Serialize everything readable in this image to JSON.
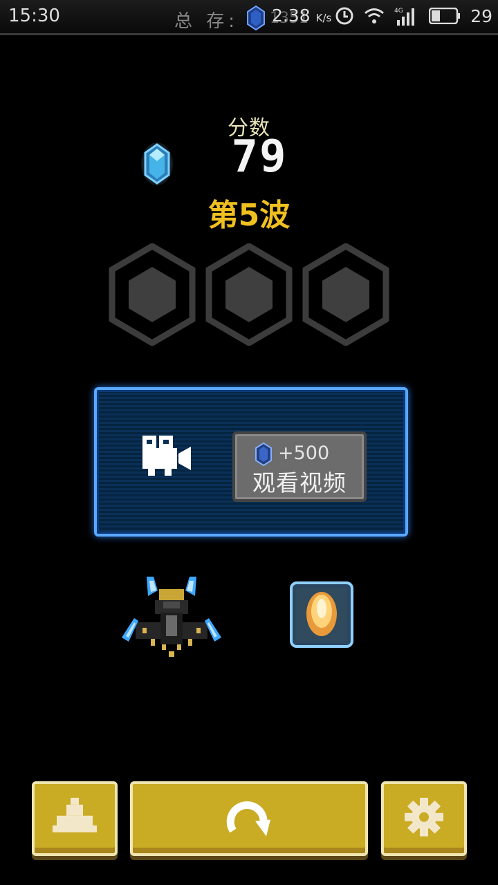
{
  "status_bar": {
    "time": "15:30",
    "storage_label": "总 存:",
    "gem_total": "1351",
    "net_speed": "2.38",
    "net_speed_unit": "K/s",
    "battery": "29"
  },
  "score": {
    "label": "分数",
    "value": "79",
    "wave": "第5波"
  },
  "stars": {
    "slots": 3,
    "earned": 0
  },
  "video_offer": {
    "reward": "+500",
    "button_label": "观看视频"
  },
  "colors": {
    "wave_text": "#f0c020",
    "panel_border": "#5aa8ff",
    "button_gold": "#c9ab24"
  },
  "icons": [
    "gem-icon",
    "camera-icon",
    "ship-icon",
    "boost-icon",
    "restart-icon",
    "gear-icon"
  ]
}
